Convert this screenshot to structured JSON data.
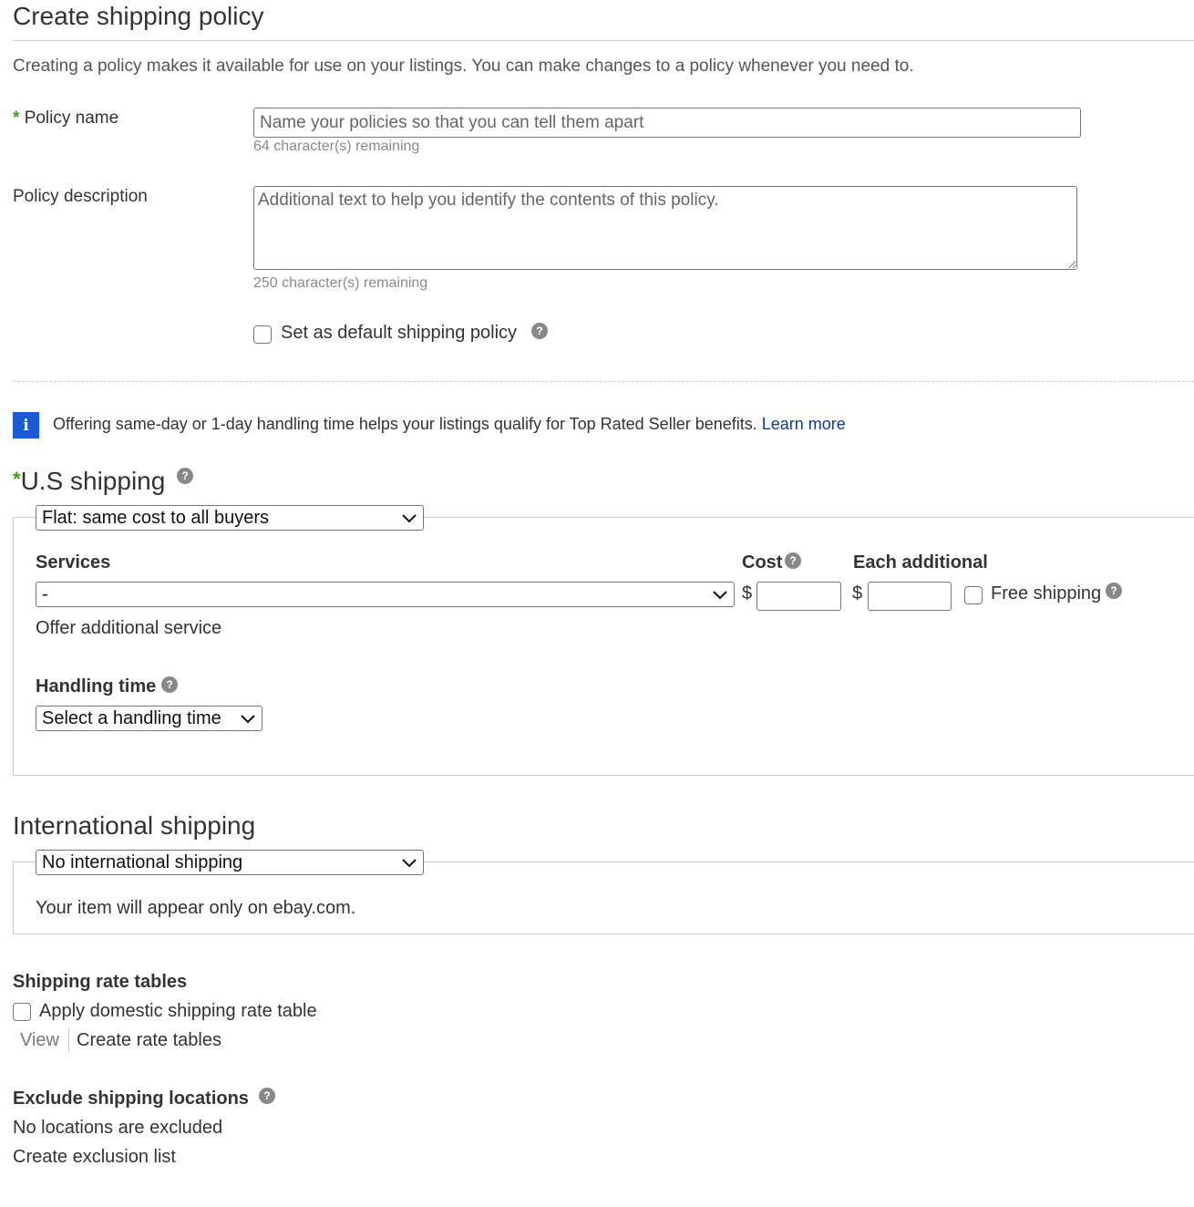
{
  "page": {
    "title": "Create shipping policy",
    "intro": "Creating a policy makes it available for use on your listings. You can make changes to a policy whenever you need to."
  },
  "policy_name": {
    "required_marker": "*",
    "label": "Policy name",
    "value": "",
    "placeholder": "Name your policies so that you can tell them apart",
    "remaining": "64 character(s) remaining"
  },
  "policy_description": {
    "label": "Policy description",
    "value": "",
    "placeholder": "Additional text to help you identify the contents of this policy.",
    "remaining": "250 character(s) remaining"
  },
  "default_policy": {
    "label": "Set as default shipping policy",
    "checked": false
  },
  "info_banner": {
    "icon": "info-icon",
    "icon_glyph": "i",
    "text": "Offering same-day or 1-day handling time helps your listings qualify for Top Rated Seller benefits.",
    "link": "Learn more",
    "icon_color": "#1a5bd6"
  },
  "us_shipping": {
    "required_marker": "*",
    "heading": "U.S shipping",
    "type_select": "Flat: same cost to all buyers",
    "services_label": "Services",
    "service_select": "-",
    "cost_label": "Cost",
    "each_additional_label": "Each additional",
    "currency": "$",
    "cost_value": "",
    "each_additional_value": "",
    "free_shipping_label": "Free shipping",
    "free_shipping_checked": false,
    "offer_additional_link": "Offer additional service",
    "handling_label": "Handling time",
    "handling_select": "Select a handling time"
  },
  "international_shipping": {
    "heading": "International shipping",
    "type_select": "No international shipping",
    "note": "Your item will appear only on ebay.com."
  },
  "rate_tables": {
    "heading": "Shipping rate tables",
    "checkbox_label": "Apply domestic shipping rate table",
    "checked": false,
    "view_label": "View",
    "create_link": "Create rate tables"
  },
  "exclusions": {
    "heading": "Exclude shipping locations",
    "status": "No locations are excluded",
    "create_link": "Create exclusion list"
  },
  "icons": {
    "help_glyph": "?"
  },
  "colors": {
    "link": "#0b3c9c",
    "required": "#3d9d1f",
    "info": "#1a5bd6"
  }
}
